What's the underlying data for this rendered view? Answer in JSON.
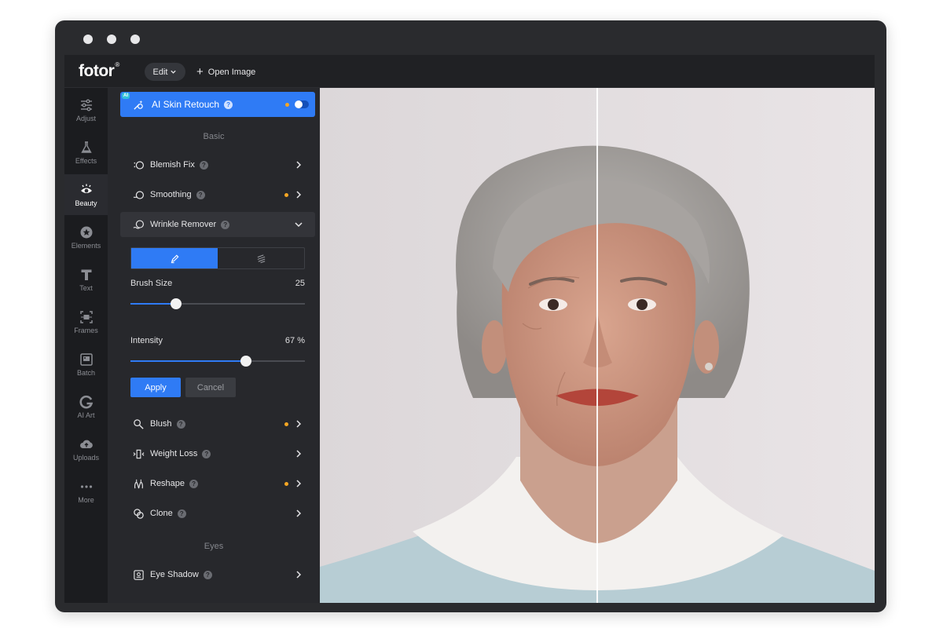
{
  "app": {
    "logo": "fotor",
    "logo_mark": "®"
  },
  "topbar": {
    "edit_label": "Edit",
    "open_label": "Open Image"
  },
  "rail": [
    {
      "label": "Adjust",
      "icon": "sliders-icon"
    },
    {
      "label": "Effects",
      "icon": "flask-icon"
    },
    {
      "label": "Beauty",
      "icon": "eye-icon",
      "active": true
    },
    {
      "label": "Elements",
      "icon": "star-circle-icon"
    },
    {
      "label": "Text",
      "icon": "text-icon"
    },
    {
      "label": "Frames",
      "icon": "frame-icon"
    },
    {
      "label": "Batch",
      "icon": "batch-icon"
    },
    {
      "label": "AI Art",
      "icon": "ai-art-icon"
    },
    {
      "label": "Uploads",
      "icon": "cloud-upload-icon"
    },
    {
      "label": "More",
      "icon": "more-icon"
    }
  ],
  "panel": {
    "ai_badge": "AI",
    "ai_title": "AI Skin Retouch",
    "section_basic": "Basic",
    "section_eyes": "Eyes",
    "items": {
      "blemish": "Blemish Fix",
      "smoothing": "Smoothing",
      "wrinkle": "Wrinkle Remover",
      "blush": "Blush",
      "weight": "Weight Loss",
      "reshape": "Reshape",
      "clone": "Clone",
      "eyeshadow": "Eye Shadow"
    },
    "brush_size_label": "Brush Size",
    "brush_size_value": "25",
    "intensity_label": "Intensity",
    "intensity_value": "67 %",
    "brush_fraction": 0.26,
    "intensity_fraction": 0.66,
    "apply_label": "Apply",
    "cancel_label": "Cancel"
  },
  "colors": {
    "accent": "#2f7bf5",
    "indicator": "#f5a623"
  }
}
